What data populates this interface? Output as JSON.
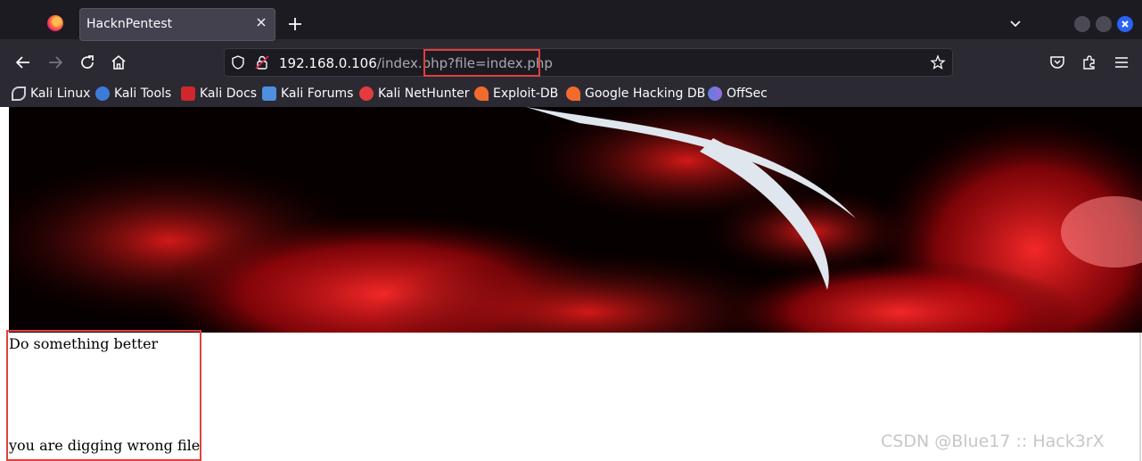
{
  "browser": {
    "tab": {
      "title": "HacknPentest"
    },
    "url": {
      "host": "192.168.0.106",
      "path": "/index.php",
      "query": "?file=index.php"
    }
  },
  "bookmarks": [
    {
      "label": "Kali Linux",
      "icon": "kali-dragon-icon",
      "color": "#cfcfd8"
    },
    {
      "label": "Kali Tools",
      "icon": "kali-tools-icon",
      "color": "#3d7bd8"
    },
    {
      "label": "Kali Docs",
      "icon": "kali-docs-icon",
      "color": "#d1262d"
    },
    {
      "label": "Kali Forums",
      "icon": "kali-forums-icon",
      "color": "#4e8fe0"
    },
    {
      "label": "Kali NetHunter",
      "icon": "kali-nethunter-icon",
      "color": "#e23c3c"
    },
    {
      "label": "Exploit-DB",
      "icon": "exploit-db-icon",
      "color": "#f26b2d"
    },
    {
      "label": "Google Hacking DB",
      "icon": "ghdb-icon",
      "color": "#f26b2d"
    },
    {
      "label": "OffSec",
      "icon": "offsec-icon",
      "color": "#5b7fe0"
    }
  ],
  "page": {
    "line1": "Do something better",
    "line2": "you are digging wrong file"
  },
  "watermark": "CSDN @Blue17 :: Hack3rX",
  "colors": {
    "highlight": "#e1403e",
    "banner_red": "#c8121a",
    "accent": "#2a62f4"
  }
}
